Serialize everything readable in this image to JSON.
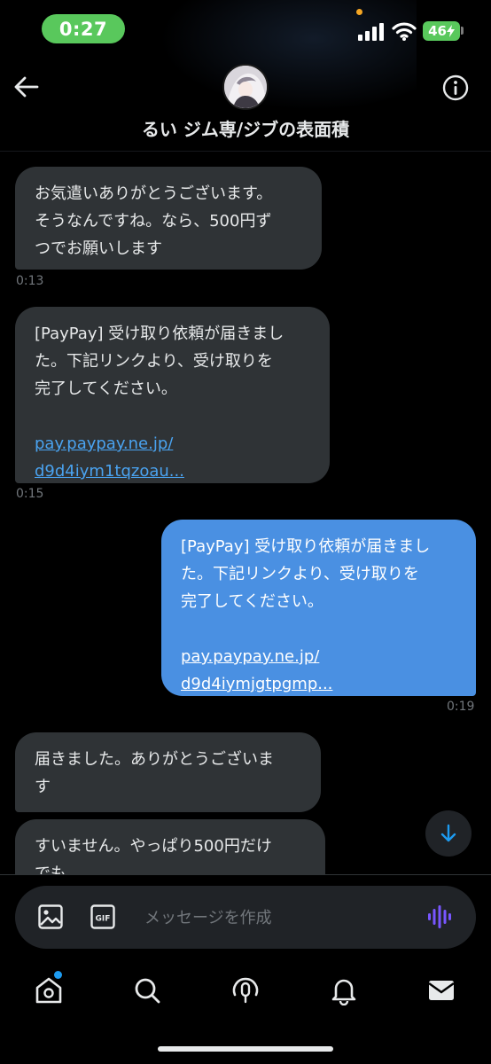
{
  "status_bar": {
    "time": "0:27",
    "battery": "46"
  },
  "header": {
    "title": "るい ジム専/ジブの表面積"
  },
  "messages": [
    {
      "direction": "in",
      "lines": [
        "お気遣いありがとうございます。",
        "そうなんですね。なら、500円ず",
        "つでお願いします"
      ],
      "time": "0:13"
    },
    {
      "direction": "in",
      "lines": [
        "[PayPay] 受け取り依頼が届きまし",
        "た。下記リンクより、受け取りを",
        "完了してください。"
      ],
      "link_lines": [
        "pay.paypay.ne.jp/",
        "d9d4iym1tqzoau..."
      ],
      "time": "0:15"
    },
    {
      "direction": "out",
      "lines": [
        "[PayPay] 受け取り依頼が届きまし",
        "た。下記リンクより、受け取りを",
        "完了してください。"
      ],
      "link_lines": [
        "pay.paypay.ne.jp/",
        "d9d4iymjgtpgmp..."
      ],
      "time": "0:19"
    },
    {
      "direction": "in",
      "lines": [
        "届きました。ありがとうございま",
        "す"
      ]
    },
    {
      "direction": "in",
      "lines": [
        "すいません。やっぱり500円だけ",
        "でも。。。"
      ]
    }
  ],
  "composer": {
    "placeholder": "メッセージを作成",
    "gif_label": "GIF"
  },
  "colors": {
    "background": "#000000",
    "incoming_bubble": "#2f3336",
    "outgoing_bubble": "#4a90e2",
    "link": "#4aa3f0",
    "timestamp": "#71767b",
    "time_pill": "#59c85c",
    "voice_icon": "#7856ff",
    "notification_dot": "#1d9bf0"
  },
  "icons": {
    "back": "arrow-left-icon",
    "info": "info-icon",
    "scroll_down": "arrow-down-icon",
    "image": "image-icon",
    "gif": "gif-icon",
    "voice": "voice-wave-icon",
    "nav": [
      "home-icon",
      "search-icon",
      "spaces-icon",
      "bell-icon",
      "mail-icon"
    ]
  }
}
